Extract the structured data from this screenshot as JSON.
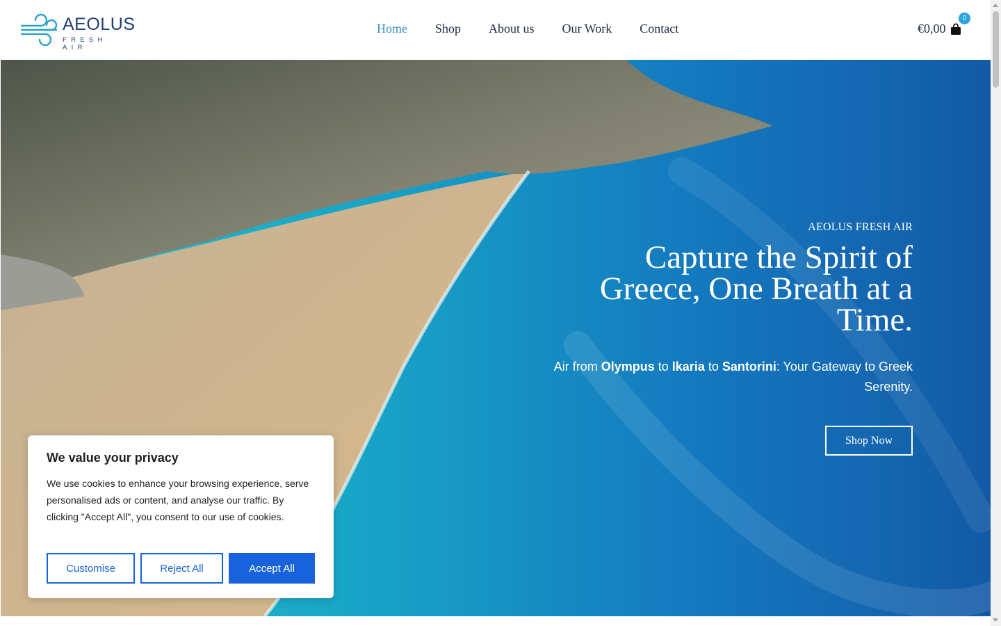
{
  "brand": {
    "name": "AEOLUS",
    "sub": "FRESH AIR"
  },
  "nav": {
    "items": [
      {
        "label": "Home",
        "active": true
      },
      {
        "label": "Shop",
        "active": false
      },
      {
        "label": "About us",
        "active": false
      },
      {
        "label": "Our Work",
        "active": false
      },
      {
        "label": "Contact",
        "active": false
      }
    ]
  },
  "cart": {
    "total": "€0,00",
    "count": "0",
    "icon": "shopping-bag-icon"
  },
  "hero": {
    "eyebrow": "AEOLUS FRESH AIR",
    "headline": "Capture the Spirit of Greece, One Breath at a Time.",
    "tagline_parts": [
      "Air from ",
      "Olympus",
      " to ",
      "Ikaria",
      " to ",
      "Santorini",
      ": Your Gateway to Greek Serenity."
    ],
    "cta": "Shop Now"
  },
  "cookie": {
    "title": "We value your privacy",
    "body": "We use cookies to enhance your browsing experience, serve personalised ads or content, and analyse our traffic. By clicking \"Accept All\", you consent to our use of cookies.",
    "customise": "Customise",
    "reject": "Reject All",
    "accept": "Accept All"
  },
  "colors": {
    "accent": "#3a8fc4",
    "badge": "#2ba3dc",
    "cookie_primary": "#1863dc",
    "text_dark": "#1b2a44"
  }
}
